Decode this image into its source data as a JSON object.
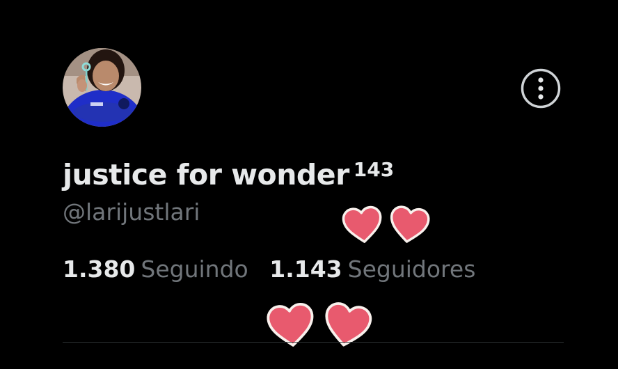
{
  "profile": {
    "display_name": "justice for wonder",
    "name_suffix": "143",
    "handle": "@larijustlari",
    "avatar": "profile-avatar-photo",
    "more_icon": "more-options-icon"
  },
  "stats": {
    "following": {
      "count": "1.380",
      "label": "Seguindo"
    },
    "followers": {
      "count": "1.143",
      "label": "Seguidores"
    }
  },
  "stickers": {
    "icon": "heart-icon",
    "color": "#e85a6e"
  },
  "colors": {
    "background": "#000000",
    "primary_text": "#e7e9ea",
    "secondary_text": "#71767b",
    "divider": "#2f3336"
  }
}
